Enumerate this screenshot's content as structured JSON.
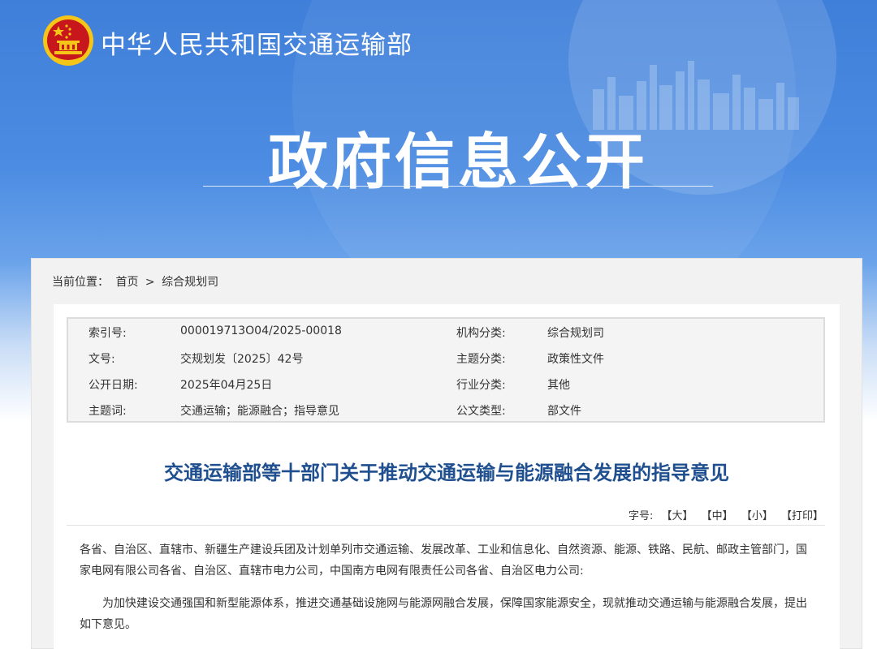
{
  "header": {
    "site_name": "中华人民共和国交通运输部",
    "big_title": "政府信息公开"
  },
  "breadcrumb": {
    "prefix": "当前位置：",
    "home": "首页",
    "separator": ">",
    "current": "综合规划司"
  },
  "meta": {
    "rows": [
      {
        "label1": "索引号:",
        "value1": "000019713O04/2025-00018",
        "label2": "机构分类:",
        "value2": "综合规划司"
      },
      {
        "label1": "文号:",
        "value1": "交规划发〔2025〕42号",
        "label2": "主题分类:",
        "value2": "政策性文件"
      },
      {
        "label1": "公开日期:",
        "value1": "2025年04月25日",
        "label2": "行业分类:",
        "value2": "其他"
      },
      {
        "label1": "主题词:",
        "value1": "交通运输；能源融合；指导意见",
        "label2": "公文类型:",
        "value2": "部文件"
      }
    ]
  },
  "document": {
    "title": "交通运输部等十部门关于推动交通运输与能源融合发展的指导意见",
    "size_label": "字号:",
    "size_large": "【大】",
    "size_medium": "【中】",
    "size_small": "【小】",
    "print": "【打印】",
    "para1": "各省、自治区、直辖市、新疆生产建设兵团及计划单列市交通运输、发展改革、工业和信息化、自然资源、能源、铁路、民航、邮政主管部门，国家电网有限公司各省、自治区、直辖市电力公司，中国南方电网有限责任公司各省、自治区电力公司:",
    "para2": "为加快建设交通强国和新型能源体系，推进交通基础设施网与能源网融合发展，保障国家能源安全，现就推动交通运输与能源融合发展，提出如下意见。"
  },
  "colors": {
    "header_blue": "#4c8ce2",
    "title_blue": "#1f4f8f",
    "emblem_red": "#c8161d",
    "emblem_gold": "#f5c518"
  }
}
